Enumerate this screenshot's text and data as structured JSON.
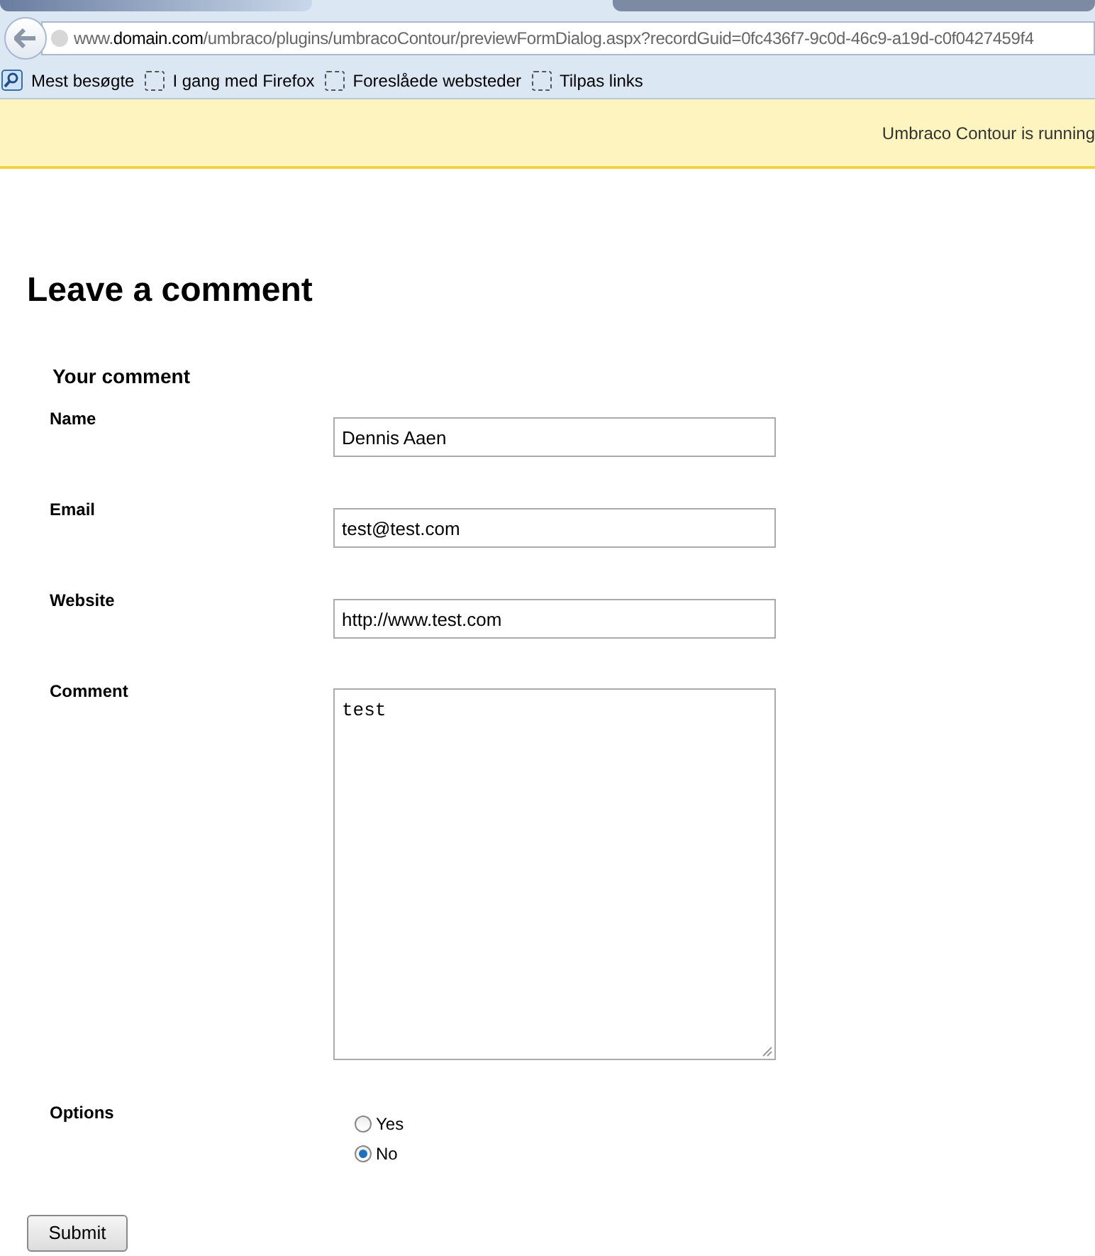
{
  "browser": {
    "address": "www.**domain.com**/umbraco/plugins/umbracoContour/previewFormDialog.aspx?recordGuid=0fc436f7-9c0d-46c9-a19d-c0f0427459f4",
    "bookmarks": [
      {
        "label": "Mest besøgte",
        "kind": "search"
      },
      {
        "label": "I gang med Firefox",
        "kind": "folder"
      },
      {
        "label": "Foreslåede websteder",
        "kind": "folder"
      },
      {
        "label": "Tilpas links",
        "kind": "folder"
      }
    ]
  },
  "notice": "Umbraco Contour is running",
  "form": {
    "title": "Leave a comment",
    "legend": "Your comment",
    "fields": [
      {
        "label": "Name",
        "kind": "text",
        "value": "Dennis Aaen"
      },
      {
        "label": "Email",
        "kind": "text",
        "value": "test@test.com"
      },
      {
        "label": "Website",
        "kind": "text",
        "value": "http://www.test.com"
      },
      {
        "label": "Comment",
        "kind": "textarea",
        "value": "test"
      },
      {
        "label": "Options",
        "kind": "radio",
        "options": [
          {
            "label": "Yes",
            "selected": false
          },
          {
            "label": "No",
            "selected": true
          }
        ]
      }
    ],
    "submit": "Submit"
  }
}
